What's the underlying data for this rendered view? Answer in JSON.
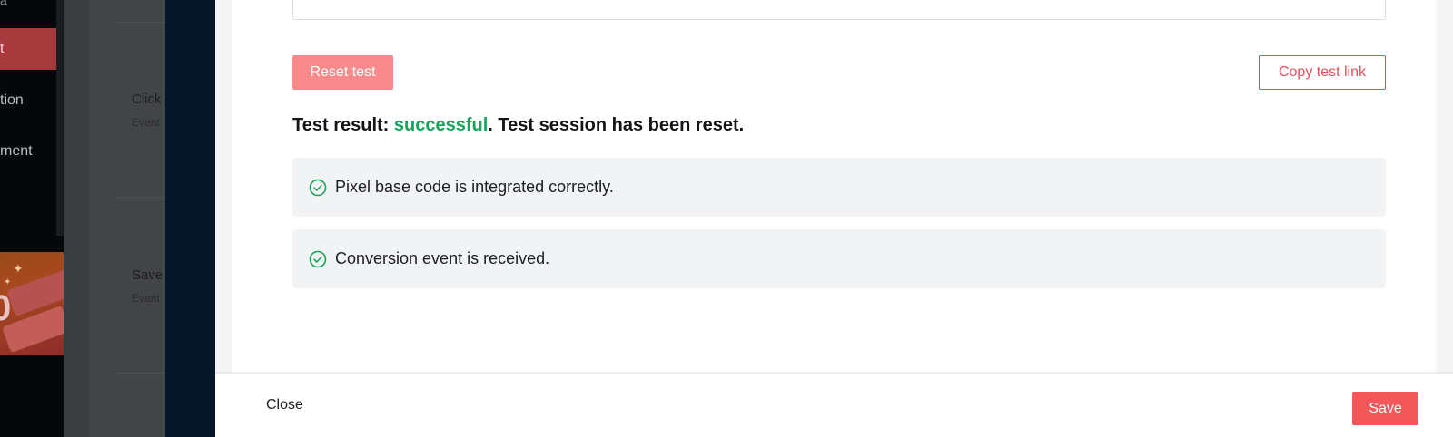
{
  "background": {
    "nav": {
      "top_fragment": "a",
      "items": [
        {
          "label": "t",
          "active": true
        },
        {
          "label": "tion",
          "active": false
        },
        {
          "label": "ment",
          "active": false
        }
      ],
      "promo_glyph": "0"
    },
    "events": [
      {
        "title": "Click",
        "subtitle": "Event"
      },
      {
        "title": "Save",
        "subtitle": "Event"
      }
    ]
  },
  "test_panel": {
    "reset_button": "Reset test",
    "copy_link_button": "Copy test link",
    "result": {
      "prefix": "Test result: ",
      "status": "successful",
      "suffix": ". Test session has been reset."
    },
    "checks": [
      {
        "icon": "check-circle-icon",
        "text": "Pixel base code is integrated correctly."
      },
      {
        "icon": "check-circle-icon",
        "text": "Conversion event is received."
      }
    ]
  },
  "footer": {
    "close_label": "Close",
    "save_label": "Save"
  },
  "colors": {
    "accent": "#f4575a",
    "accent_light": "#f98a8c",
    "success": "#1aa35a",
    "card_bg": "#f2f3f4"
  }
}
